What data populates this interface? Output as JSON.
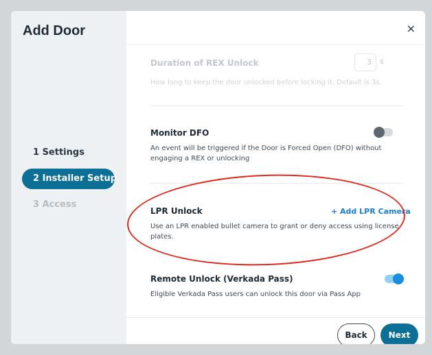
{
  "modal": {
    "title": "Add Door",
    "close_symbol": "×"
  },
  "steps": [
    {
      "label": "1  Settings",
      "state": "done"
    },
    {
      "label": "2  Installer Setup",
      "state": "active"
    },
    {
      "label": "3  Access",
      "state": "disabled"
    }
  ],
  "settings": {
    "rex": {
      "title": "Duration of REX Unlock",
      "description": "How long to keep the door unlocked before locking it. Default is 3s.",
      "value": "3",
      "unit": "s"
    },
    "dfo": {
      "title": "Monitor DFO",
      "description": "An event will be triggered if the Door is Forced Open (DFO) without engaging a REX or unlocking",
      "enabled": false
    },
    "lpr": {
      "title": "LPR Unlock",
      "link": "+ Add LPR Camera",
      "description": "Use an LPR enabled bullet camera to grant or deny access using license plates."
    },
    "remote": {
      "title": "Remote Unlock (Verkada Pass)",
      "description": "Eligible Verkada Pass users can unlock this door via Pass App",
      "enabled": true
    }
  },
  "footer": {
    "back_label": "Back",
    "next_label": "Next"
  },
  "colors": {
    "primary": "#0b6f96",
    "link": "#1a7fd1",
    "annotation": "#e4261b",
    "toggle_on": "#1a8fe0"
  }
}
